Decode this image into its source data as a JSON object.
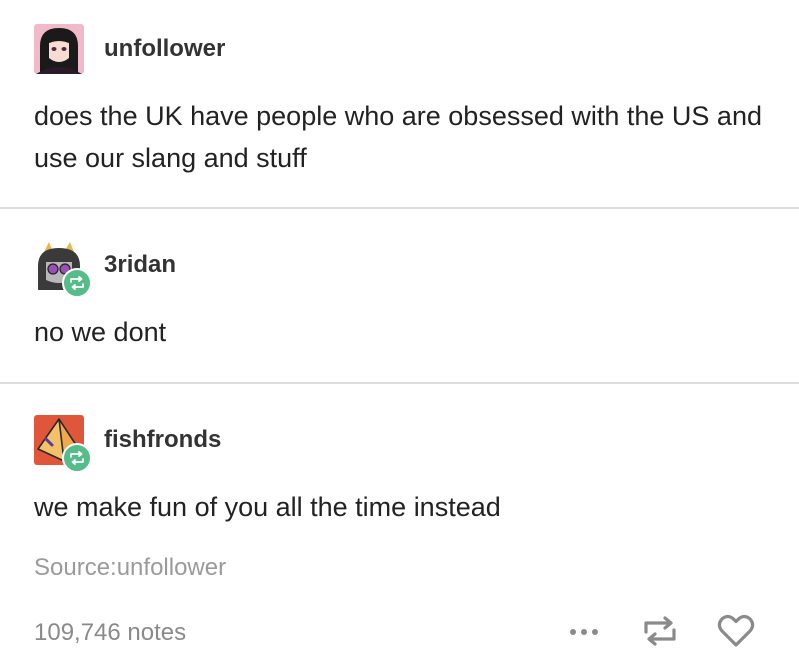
{
  "posts": [
    {
      "username": "unfollower",
      "text": "does the UK have people who are obsessed with the US and use our slang and stuff"
    },
    {
      "username": "3ridan",
      "text": "no we dont"
    },
    {
      "username": "fishfronds",
      "text": "we make fun of you all the time instead"
    }
  ],
  "footer": {
    "source": "Source:unfollower",
    "notes": "109,746 notes"
  },
  "icons": {
    "more": "more-options-icon",
    "reblog": "reblog-icon",
    "like": "heart-icon",
    "badge": "reblog-badge-icon"
  },
  "colors": {
    "reblog_badge": "#56bc8a",
    "divider": "#dcdcdc",
    "source_text": "#9a9a9a",
    "icon_gray": "#8a8a8a"
  }
}
